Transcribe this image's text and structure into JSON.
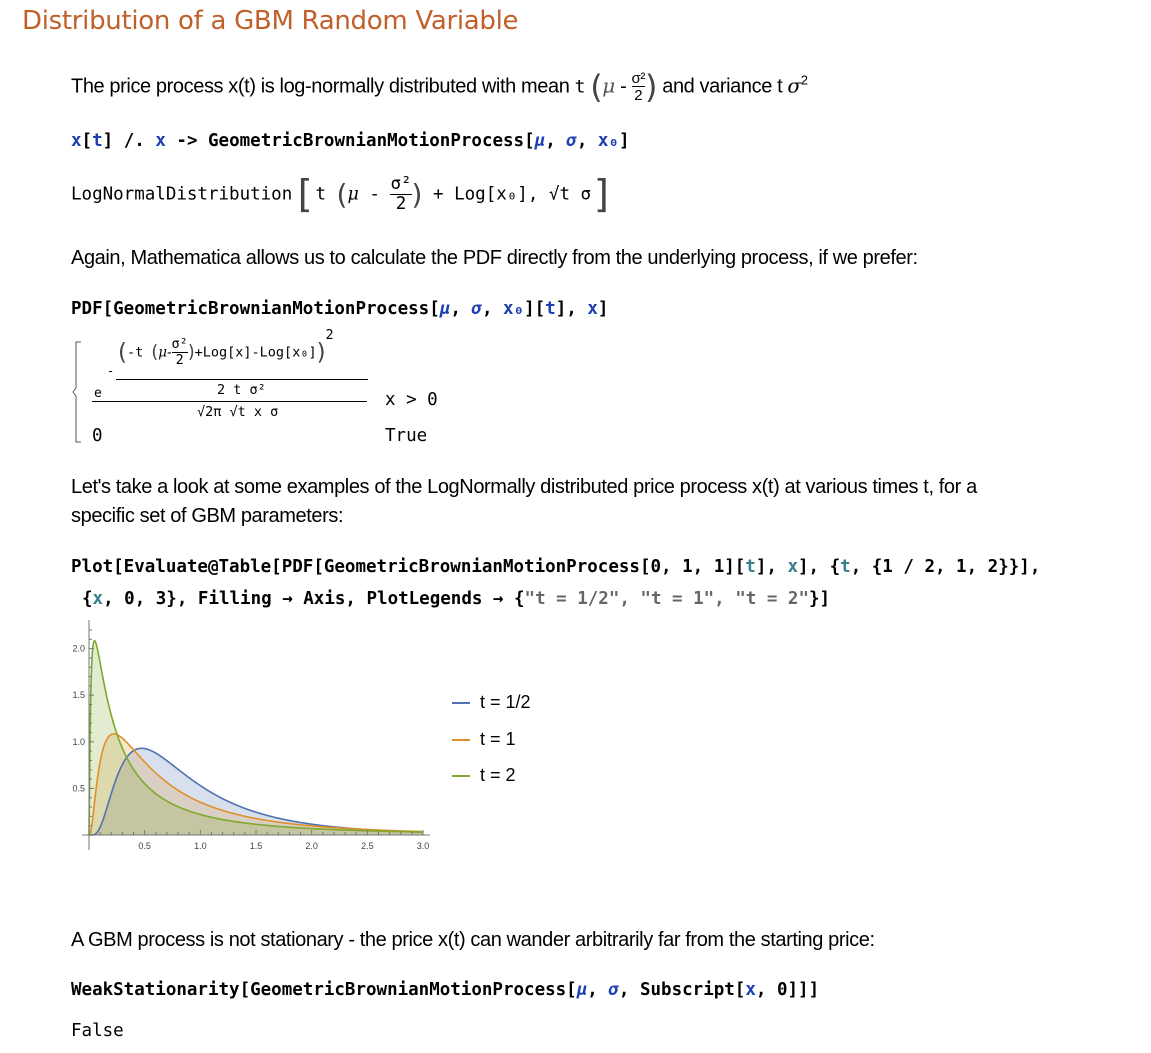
{
  "section_title": "Distribution of a GBM Random Variable",
  "para1": {
    "before": "The price process x(t) is log-normally distributed with mean ",
    "mean_t": "t",
    "mean_mu": "μ",
    "mean_minus": "-",
    "mean_num": "σ²",
    "mean_den": "2",
    "after": "and variance t ",
    "variance_sym": "σ",
    "variance_exp": "2"
  },
  "input1": {
    "x": "x",
    "open": "[",
    "t": "t",
    "close": "] /. ",
    "x2": "x",
    "arrow": " -> GeometricBrownianMotionProcess[",
    "mu": "μ",
    "comma1": ", ",
    "sigma": "σ",
    "comma2": ", ",
    "x0": "x₀",
    "end": "]"
  },
  "output1": {
    "head": "LogNormalDistribution",
    "t": "t",
    "mu": "μ",
    "minus": " - ",
    "num": "σ²",
    "den": "2",
    "plus": " + Log[x₀], ",
    "sqrt": "√t",
    "sigma": " σ"
  },
  "para2": "Again, Mathematica allows us to calculate the PDF directly from the underlying process, if we prefer:",
  "input2": {
    "head": "PDF[GeometricBrownianMotionProcess[",
    "mu": "μ",
    "c1": ", ",
    "sigma": "σ",
    "c2": ", ",
    "x0": "x₀",
    "mid": "][",
    "t": "t",
    "c3": "], ",
    "x": "x",
    "end": "]"
  },
  "output2": {
    "exp_base": "e",
    "exp_minus": "-",
    "exp_numerator": "(-t (μ-σ²/2) +Log[x]-Log[x₀])²",
    "exp_num_prefix": "-t",
    "exp_num_mu": "μ-",
    "exp_num_frac_num": "σ²",
    "exp_num_frac_den": "2",
    "exp_num_rest": "+Log[x]-Log[x₀]",
    "exp_num_power": "2",
    "exp_denominator": "2 t σ²",
    "denominator": "√2π √t x σ",
    "condition1": "x > 0",
    "value2": "0",
    "condition2": "True"
  },
  "para3": {
    "line1": "Let's take a look at some examples of the LogNormally distributed price process x(t) at various times t, for a",
    "line2": "specific set of GBM parameters:"
  },
  "input3": {
    "line1_a": "Plot[Evaluate@Table[PDF[GeometricBrownianMotionProcess[0, 1, 1][",
    "line1_t": "t",
    "line1_b": "], ",
    "line1_x": "x",
    "line1_c": "], {",
    "line1_t2": "t",
    "line1_d": ", {1 / 2, 1, 2}}],",
    "line2_a": "{",
    "line2_x": "x",
    "line2_b": ", 0, 3}, Filling → Axis, PlotLegends → {",
    "line2_str": "\"t = 1/2\", \"t = 1\", \"t = 2\"",
    "line2_c": "}]"
  },
  "chart_data": {
    "type": "area",
    "title": "",
    "xlabel": "",
    "ylabel": "",
    "xlim": [
      0,
      3
    ],
    "ylim": [
      0,
      2.2
    ],
    "x_ticks": [
      "0.5",
      "1.0",
      "1.5",
      "2.0",
      "2.5",
      "3.0"
    ],
    "y_ticks": [
      "0.5",
      "1.0",
      "1.5",
      "2.0"
    ],
    "filling": "axis",
    "legend_position": "right",
    "function": "LogNormal PDF with mu=-t/2, sigma=sqrt(t)",
    "series": [
      {
        "name": "t = 1/2",
        "t": 0.5,
        "color": "#4f72b0",
        "fill": "#c9d5ea",
        "peak_x": 0.47,
        "peak_y": 0.93
      },
      {
        "name": "t = 1",
        "t": 1,
        "color": "#e0902a",
        "fill": "#f3dfb8",
        "peak_x": 0.22,
        "peak_y": 1.08
      },
      {
        "name": "t = 2",
        "t": 2,
        "color": "#7fa82c",
        "fill": "#e1ebc6",
        "peak_x": 0.05,
        "peak_y": 2.08
      }
    ]
  },
  "legend": {
    "items": [
      {
        "label": "t = 1/2",
        "color": "#4f72b0"
      },
      {
        "label": "t = 1",
        "color": "#e0902a"
      },
      {
        "label": "t = 2",
        "color": "#7fa82c"
      }
    ]
  },
  "para4": "A GBM process is not stationary - the price x(t) can wander arbitrarily far from the starting price:",
  "input4": {
    "head": "WeakStationarity[GeometricBrownianMotionProcess[",
    "mu": "μ",
    "c1": ", ",
    "sigma": "σ",
    "c2": ", Subscript[",
    "x": "x",
    "end": ", 0]]]"
  },
  "output4": "False"
}
